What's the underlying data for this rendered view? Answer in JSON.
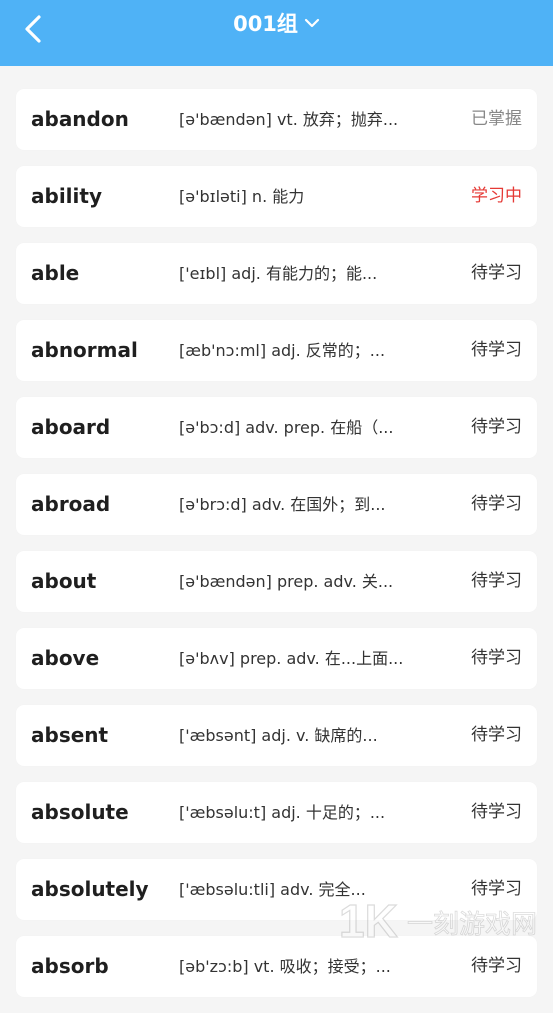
{
  "header": {
    "title": "001组",
    "back_icon": "chevron-left-icon",
    "dropdown_icon": "chevron-down-icon",
    "color": "#4fb2f6"
  },
  "colors": {
    "mastered": "#888888",
    "learning": "#e53935",
    "pending": "#333333"
  },
  "words": [
    {
      "word": "abandon",
      "def": "[ə'bændən] vt. 放弃；抛弃...",
      "status": "已掌握",
      "state": "mastered"
    },
    {
      "word": "ability",
      "def": "[ə'bɪləti] n. 能力",
      "status": "学习中",
      "state": "learning"
    },
    {
      "word": "able",
      "def": "['eɪbl] adj. 有能力的；能...",
      "status": "待学习",
      "state": "pending"
    },
    {
      "word": "abnormal",
      "def": "[æb'nɔ:ml] adj. 反常的；...",
      "status": "待学习",
      "state": "pending"
    },
    {
      "word": "aboard",
      "def": "[ə'bɔ:d] adv.  prep. 在船（...",
      "status": "待学习",
      "state": "pending"
    },
    {
      "word": "abroad",
      "def": "[ə'brɔ:d] adv. 在国外；到...",
      "status": "待学习",
      "state": "pending"
    },
    {
      "word": "about",
      "def": "[ə'bændən] prep. adv. 关...",
      "status": "待学习",
      "state": "pending"
    },
    {
      "word": "above",
      "def": "[ə'bʌv] prep. adv. 在...上面...",
      "status": "待学习",
      "state": "pending"
    },
    {
      "word": "absent",
      "def": "['æbsənt] adj.  v.  缺席的...",
      "status": "待学习",
      "state": "pending"
    },
    {
      "word": "absolute",
      "def": "['æbsəlu:t] adj. 十足的；...",
      "status": "待学习",
      "state": "pending"
    },
    {
      "word": "absolutely",
      "def": "['æbsəlu:tli] adv.  完全...",
      "status": "待学习",
      "state": "pending"
    },
    {
      "word": "absorb",
      "def": "[əb'zɔ:b] vt. 吸收；接受；...",
      "status": "待学习",
      "state": "pending"
    }
  ],
  "watermark": {
    "logo_text": "1K",
    "text": "一刻游戏网"
  }
}
